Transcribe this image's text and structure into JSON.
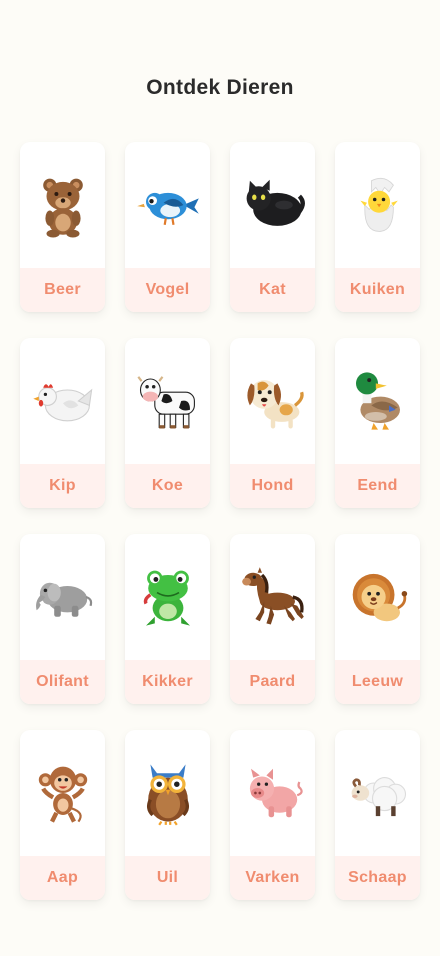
{
  "header": {
    "title": "Ontdek Dieren"
  },
  "animals": [
    {
      "name": "Beer",
      "icon": "bear-icon"
    },
    {
      "name": "Vogel",
      "icon": "bird-icon"
    },
    {
      "name": "Kat",
      "icon": "cat-icon"
    },
    {
      "name": "Kuiken",
      "icon": "chick-icon"
    },
    {
      "name": "Kip",
      "icon": "hen-icon"
    },
    {
      "name": "Koe",
      "icon": "cow-icon"
    },
    {
      "name": "Hond",
      "icon": "dog-icon"
    },
    {
      "name": "Eend",
      "icon": "duck-icon"
    },
    {
      "name": "Olifant",
      "icon": "elephant-icon"
    },
    {
      "name": "Kikker",
      "icon": "frog-icon"
    },
    {
      "name": "Paard",
      "icon": "horse-icon"
    },
    {
      "name": "Leeuw",
      "icon": "lion-icon"
    },
    {
      "name": "Aap",
      "icon": "monkey-icon"
    },
    {
      "name": "Uil",
      "icon": "owl-icon"
    },
    {
      "name": "Varken",
      "icon": "pig-icon"
    },
    {
      "name": "Schaap",
      "icon": "sheep-icon"
    }
  ],
  "colors": {
    "background": "#fdfcf7",
    "label_background": "#fff1ee",
    "label_text": "#f08c6f"
  }
}
